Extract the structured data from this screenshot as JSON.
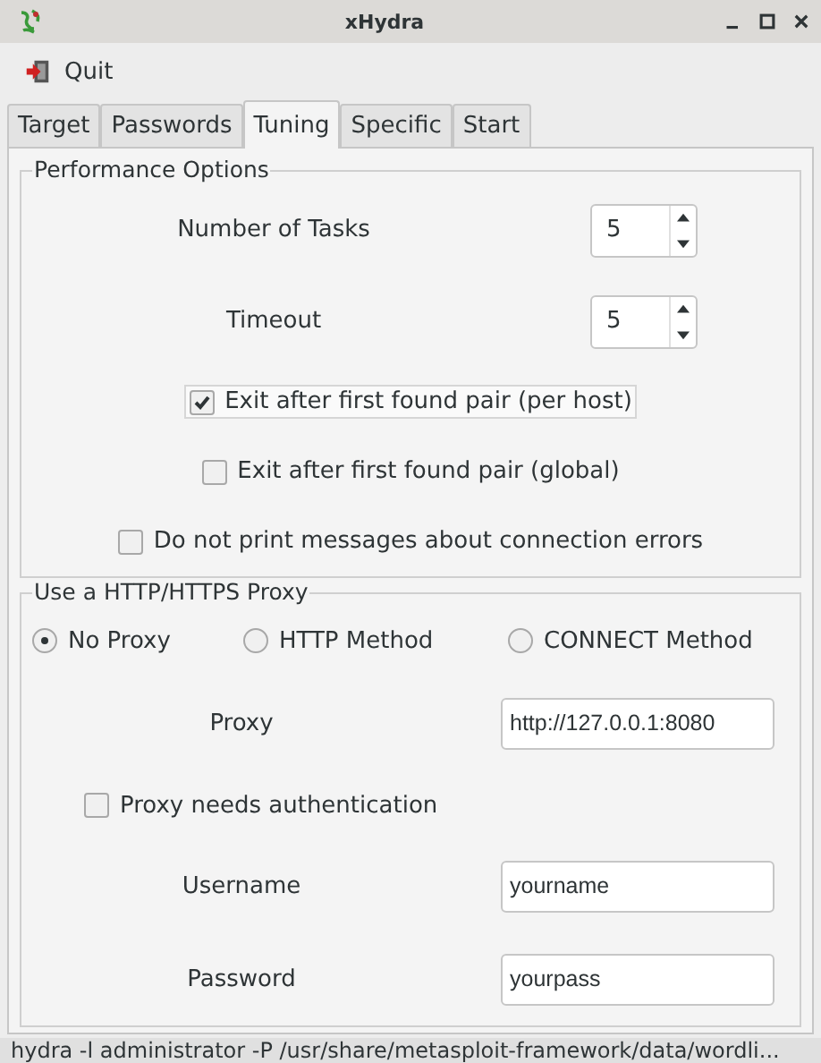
{
  "window": {
    "title": "xHydra"
  },
  "menu": [
    {
      "label": "Quit"
    }
  ],
  "tabs": [
    {
      "label": "Target",
      "selected": false
    },
    {
      "label": "Passwords",
      "selected": false
    },
    {
      "label": "Tuning",
      "selected": true
    },
    {
      "label": "Specific",
      "selected": false
    },
    {
      "label": "Start",
      "selected": false
    }
  ],
  "performance": {
    "title": "Performance Options",
    "spinners": [
      {
        "label": "Number of Tasks",
        "value": "5"
      },
      {
        "label": "Timeout",
        "value": "5"
      }
    ],
    "checkboxes": [
      {
        "label": "Exit after first found pair (per host)",
        "checked": true,
        "focused": true
      },
      {
        "label": "Exit after first found pair (global)",
        "checked": false,
        "focused": false
      },
      {
        "label": "Do not print messages about connection errors",
        "checked": false,
        "focused": false
      }
    ]
  },
  "proxy": {
    "title": "Use a HTTP/HTTPS Proxy",
    "methods": [
      {
        "label": "No Proxy",
        "selected": true
      },
      {
        "label": "HTTP Method",
        "selected": false
      },
      {
        "label": "CONNECT Method",
        "selected": false
      }
    ],
    "proxy_field": {
      "label": "Proxy",
      "value": "http://127.0.0.1:8080"
    },
    "auth": {
      "label": "Proxy needs authentication",
      "checked": false
    },
    "fields": [
      {
        "label": "Username",
        "value": "yourname"
      },
      {
        "label": "Password",
        "value": "yourpass"
      }
    ]
  },
  "status_bar": "hydra -l administrator -P /usr/share/metasploit-framework/data/wordli..."
}
